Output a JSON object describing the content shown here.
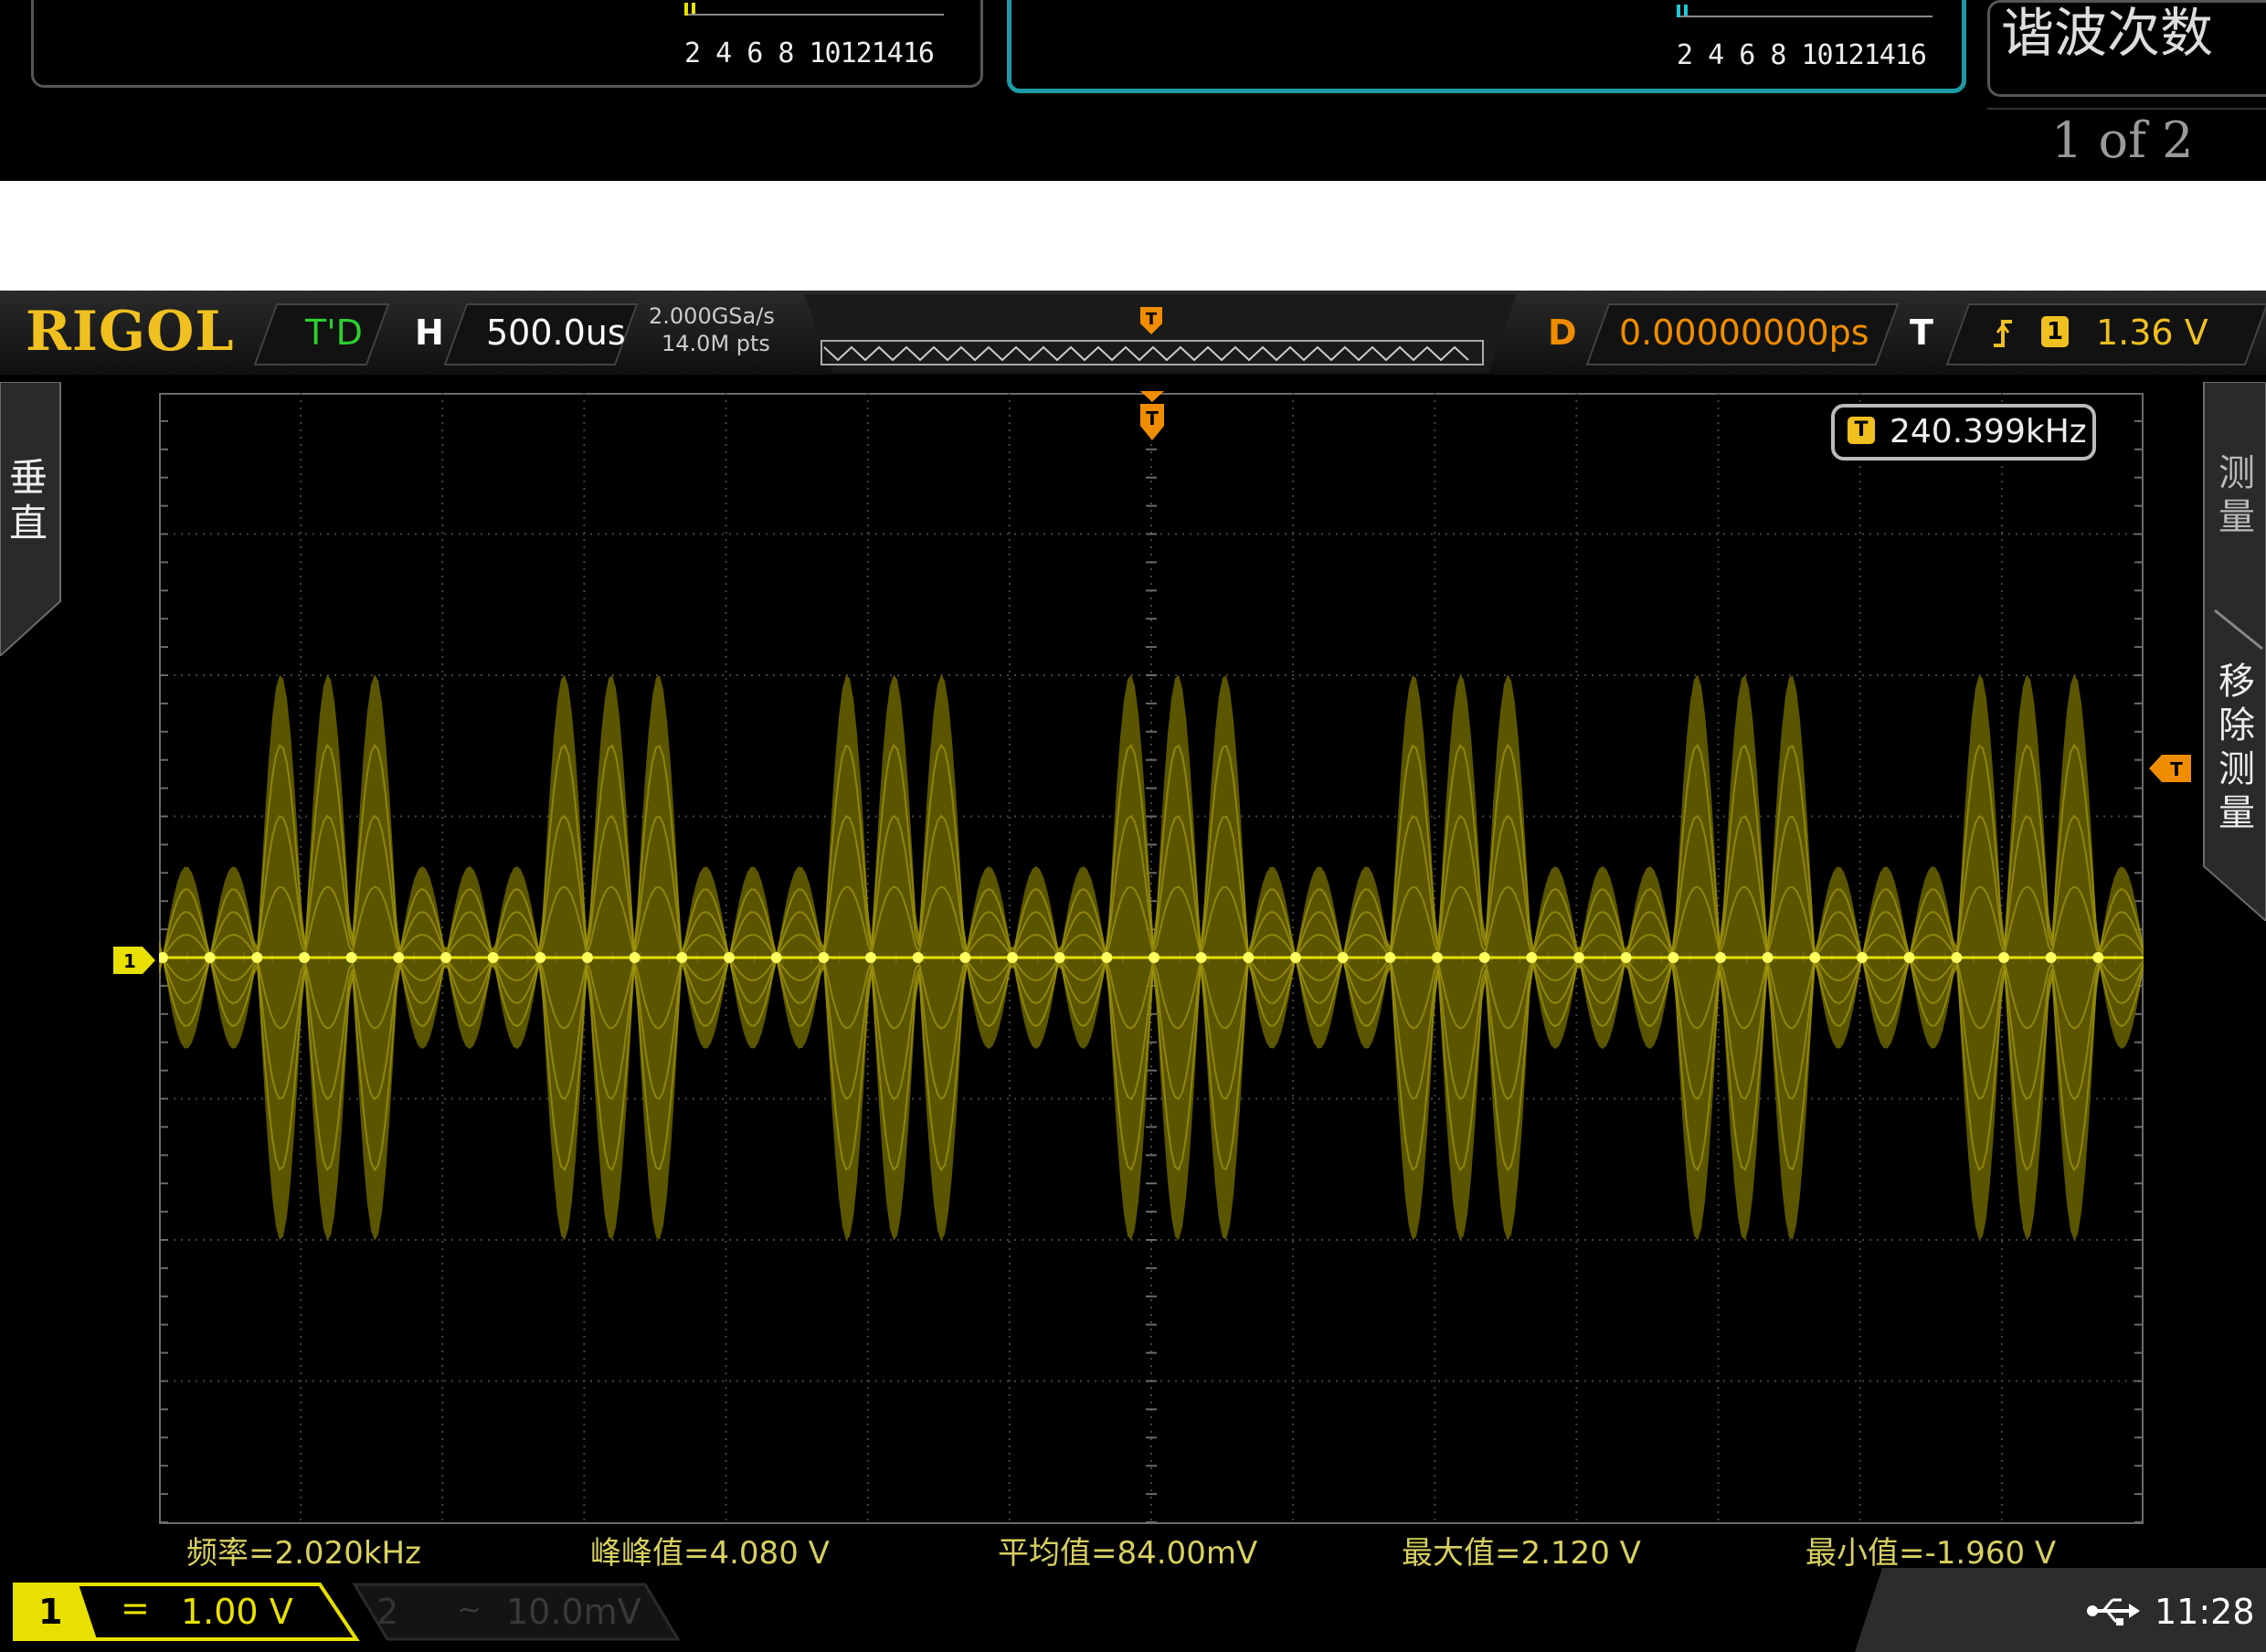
{
  "top_strip": {
    "harmonic_ticks_left": "2 4 6 8 10121416",
    "harmonic_ticks_right": "2 4 6 8 10121416",
    "harmonic_title": "谐波次数",
    "page_indicator": "1 of 2"
  },
  "scope": {
    "brand": "RIGOL",
    "run_status": "T'D",
    "horizontal_label": "H",
    "timebase": "500.0us",
    "sample_rate": "2.000GSa/s",
    "memory_depth": "14.0M pts",
    "delay_label": "D",
    "delay_value": "0.00000000ps",
    "trigger_label": "T",
    "trigger_source": "1",
    "trigger_level": "1.36 V",
    "trigger_marker": "T",
    "freq_counter_badge": "T",
    "freq_counter": "240.399kHz",
    "left_tab_label": "垂直",
    "right_tab_label_1": "测量",
    "right_tab_label_2": "移除测量",
    "channel_marker": "1",
    "ch1_number": "1",
    "ch1_coupling": "=",
    "ch1_scale": "1.00 V",
    "ch2_number": "2",
    "ch2_coupling": "~",
    "ch2_scale": "10.0mV",
    "time": "11:28",
    "usb_icon": "usb-icon"
  },
  "measurements": [
    {
      "label": "频率=2.020kHz"
    },
    {
      "label": "峰峰值=4.080 V"
    },
    {
      "label": "平均值=84.00mV"
    },
    {
      "label": "最大值=2.120 V"
    },
    {
      "label": "最小值=-1.960 V"
    }
  ],
  "colors": {
    "channel1": "#e8e000",
    "trigger": "#f08c00",
    "delay_value": "#f08c00",
    "run_status": "#2bd030",
    "teal_border": "#1e9aa6",
    "grid": "#555555"
  }
}
